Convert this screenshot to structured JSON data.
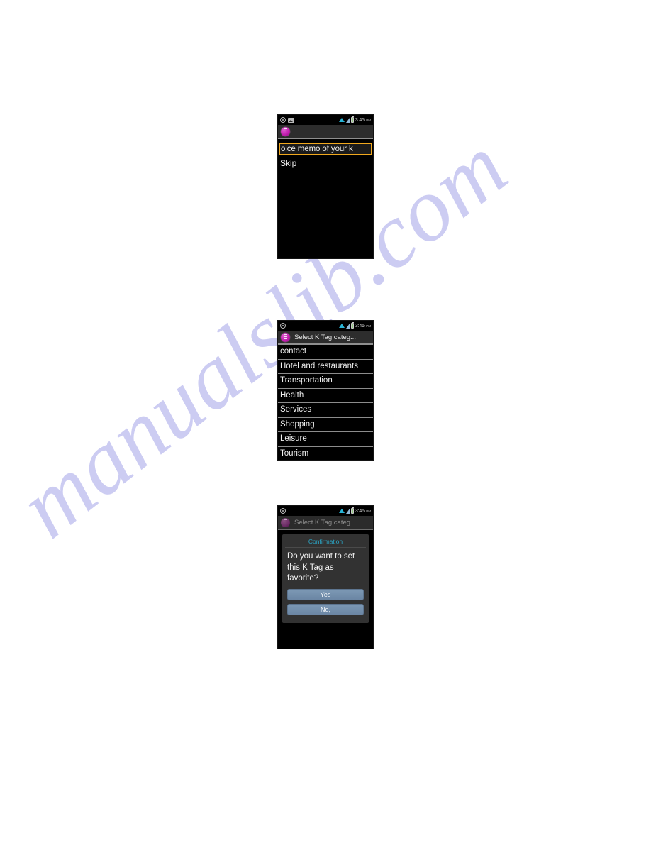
{
  "page": {
    "background": "#ffffff",
    "watermark": {
      "text": "manualslib.com",
      "color": "#ccccf2"
    }
  },
  "screenshots": [
    {
      "id": "voice-memo-screen",
      "status_bar": {
        "time": "3:45",
        "ampm": "PM",
        "left_icons": [
          "target-icon",
          "photo-icon"
        ],
        "right_icons": [
          "wifi-icon",
          "signal-icon",
          "battery-icon"
        ]
      },
      "action_bar": {
        "app_icon": "k-tag-app-icon",
        "title": ""
      },
      "text_field": {
        "value": "oice memo of your k",
        "focused": true,
        "border_color": "#f0a81e"
      },
      "skip_label": "Skip"
    },
    {
      "id": "category-list-screen",
      "status_bar": {
        "time": "3:46",
        "ampm": "PM",
        "left_icons": [
          "target-icon"
        ],
        "right_icons": [
          "wifi-icon",
          "signal-icon",
          "battery-icon"
        ]
      },
      "action_bar": {
        "app_icon": "k-tag-app-icon",
        "title": "Select K Tag categ..."
      },
      "categories": [
        "contact",
        "Hotel and restaurants",
        "Transportation",
        "Health",
        "Services",
        "Shopping",
        "Leisure",
        "Tourism"
      ]
    },
    {
      "id": "confirmation-dialog-screen",
      "status_bar": {
        "time": "3:46",
        "ampm": "PM",
        "left_icons": [
          "target-icon"
        ],
        "right_icons": [
          "wifi-icon",
          "signal-icon",
          "battery-icon"
        ]
      },
      "action_bar": {
        "app_icon": "k-tag-app-icon",
        "title": "Select K Tag categ..."
      },
      "dialog": {
        "title": "Confirmation",
        "title_color": "#2ba6c6",
        "message": "Do you want to set this K Tag as favorite?",
        "buttons": [
          {
            "label": "Yes",
            "color": "#6b86a4"
          },
          {
            "label": "No,",
            "color": "#6b86a4"
          }
        ]
      }
    }
  ]
}
